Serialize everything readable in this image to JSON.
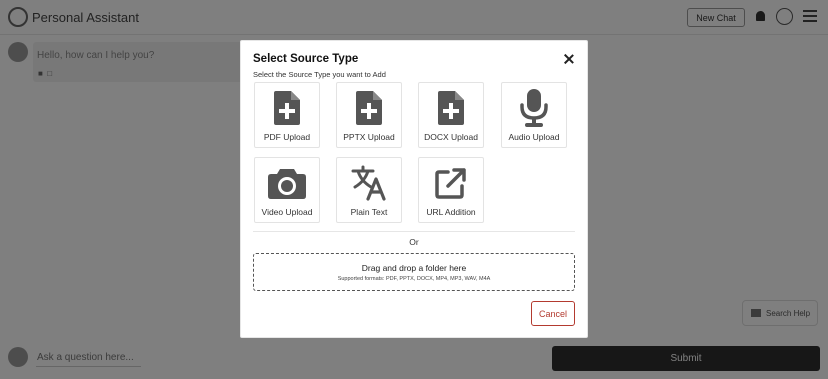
{
  "app": {
    "brand": "Personal Assistant",
    "header": {
      "new_chat": "New Chat"
    },
    "chat": {
      "message": "Hello, how can I help you?"
    },
    "bottom": {
      "placeholder": "Ask a question here...",
      "submit": "Submit"
    },
    "side_widget": "Search Help"
  },
  "modal": {
    "title": "Select Source Type",
    "subtitle": "Select the Source Type you want to Add",
    "options": [
      {
        "label": "PDF Upload",
        "icon": "file-plus-icon"
      },
      {
        "label": "PPTX Upload",
        "icon": "file-plus-icon"
      },
      {
        "label": "DOCX Upload",
        "icon": "file-plus-icon"
      },
      {
        "label": "Audio Upload",
        "icon": "microphone-icon"
      },
      {
        "label": "Video Upload",
        "icon": "camera-icon"
      },
      {
        "label": "Plain Text",
        "icon": "translate-icon"
      },
      {
        "label": "URL Addition",
        "icon": "external-link-icon"
      }
    ],
    "or": "Or",
    "dropzone": {
      "title": "Drag and drop a folder here",
      "formats": "Supported formats: PDF, PPTX, DOCX, MP4, MP3, WAV, M4A"
    },
    "cancel": "Cancel"
  },
  "colors": {
    "icon": "#555555",
    "cancel": "#b33a2f",
    "backdrop": "rgba(0,0,0,0.5)"
  }
}
